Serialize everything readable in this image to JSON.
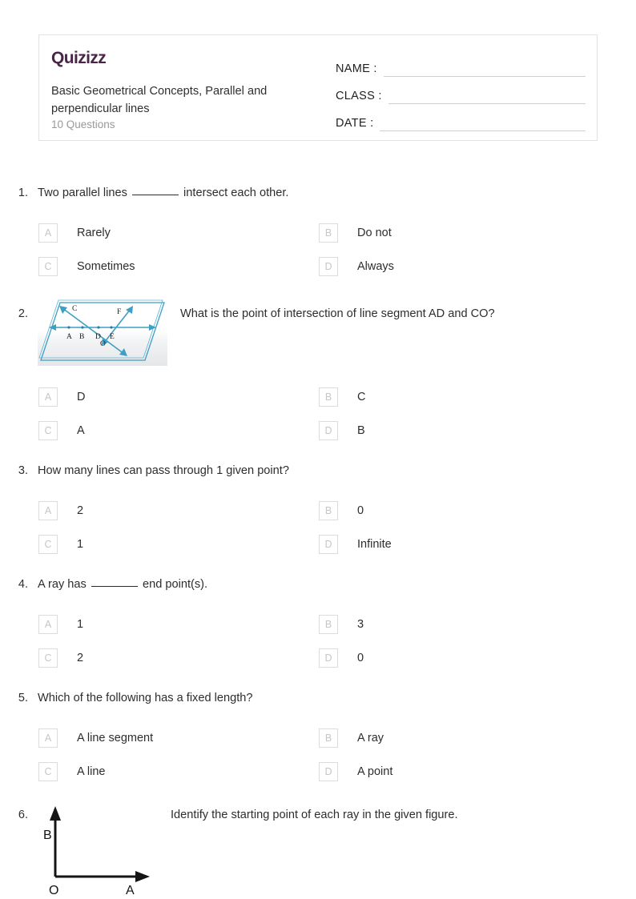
{
  "header": {
    "logo_text": "Quizizz",
    "quiz_title": "Basic Geometrical Concepts, Parallel and perpendicular lines",
    "question_count_label": "10 Questions",
    "fields": [
      {
        "label": "NAME :",
        "value": ""
      },
      {
        "label": "CLASS :",
        "value": ""
      },
      {
        "label": "DATE  :",
        "value": ""
      }
    ]
  },
  "colors": {
    "brand_purple": "#4a2545",
    "figure_teal": "#3d9fc4",
    "option_box_border": "#dcdcdc",
    "option_letter": "#c6c6c6",
    "muted_text": "#999999"
  },
  "questions": [
    {
      "number": "1.",
      "text_before_blank": "Two parallel lines ",
      "text_after_blank": " intersect each other.",
      "has_blank": true,
      "figure": null,
      "options": [
        {
          "letter": "A",
          "text": "Rarely"
        },
        {
          "letter": "B",
          "text": "Do not"
        },
        {
          "letter": "C",
          "text": "Sometimes"
        },
        {
          "letter": "D",
          "text": "Always"
        }
      ]
    },
    {
      "number": "2.",
      "text": "What is the point of intersection of line segment AD and CO?",
      "has_blank": false,
      "figure": "plane-lines-figure",
      "figure_labels": [
        "C",
        "F",
        "A",
        "B",
        "D",
        "E",
        "O"
      ],
      "options": [
        {
          "letter": "A",
          "text": "D"
        },
        {
          "letter": "B",
          "text": "C"
        },
        {
          "letter": "C",
          "text": "A"
        },
        {
          "letter": "D",
          "text": "B"
        }
      ]
    },
    {
      "number": "3.",
      "text": "How many lines can pass through 1 given point?",
      "has_blank": false,
      "figure": null,
      "options": [
        {
          "letter": "A",
          "text": "2"
        },
        {
          "letter": "B",
          "text": "0"
        },
        {
          "letter": "C",
          "text": "1"
        },
        {
          "letter": "D",
          "text": "Infinite"
        }
      ]
    },
    {
      "number": "4.",
      "text_before_blank": "A ray has ",
      "text_after_blank": " end point(s).",
      "has_blank": true,
      "figure": null,
      "options": [
        {
          "letter": "A",
          "text": "1"
        },
        {
          "letter": "B",
          "text": "3"
        },
        {
          "letter": "C",
          "text": "2"
        },
        {
          "letter": "D",
          "text": "0"
        }
      ]
    },
    {
      "number": "5.",
      "text": "Which of the following has a fixed length?",
      "has_blank": false,
      "figure": null,
      "options": [
        {
          "letter": "A",
          "text": "A line segment"
        },
        {
          "letter": "B",
          "text": "A ray"
        },
        {
          "letter": "C",
          "text": "A line"
        },
        {
          "letter": "D",
          "text": "A point"
        }
      ]
    },
    {
      "number": "6.",
      "text": "Identify the starting point of each ray in the given figure.",
      "has_blank": false,
      "figure": "two-rays-figure",
      "figure_labels": [
        "B",
        "O",
        "A"
      ],
      "options": []
    }
  ]
}
